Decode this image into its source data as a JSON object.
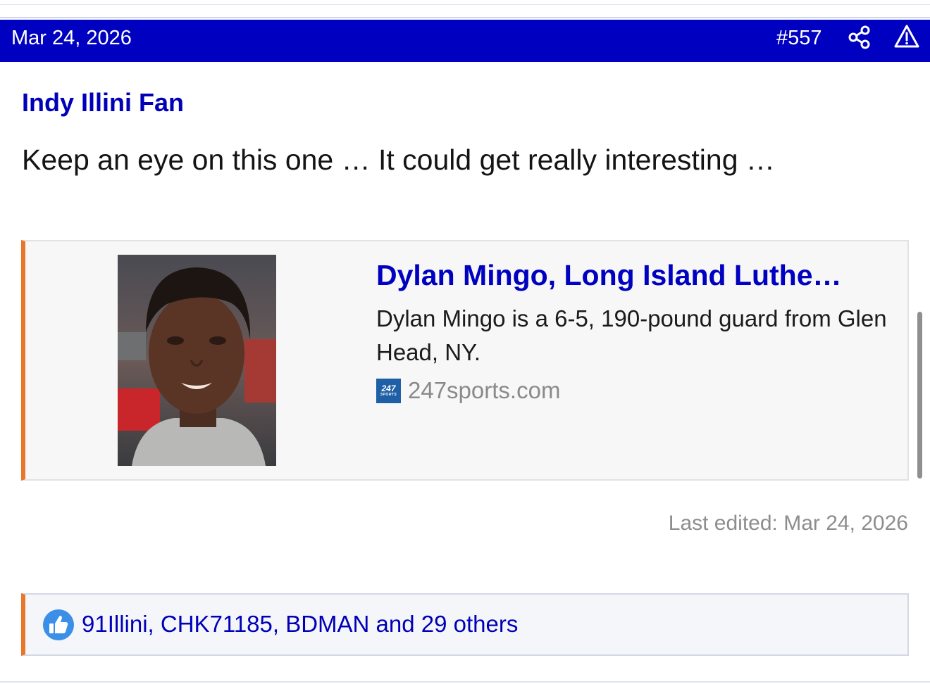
{
  "post": {
    "date": "Mar 24, 2026",
    "number": "#557",
    "author": "Indy Illini Fan",
    "message": "Keep an eye on this one … It could get really interesting …",
    "last_edited": "Last edited: Mar 24, 2026"
  },
  "embed": {
    "title": "Dylan Mingo, Long Island Luthe…",
    "description": "Dylan Mingo is a 6-5, 190-pound guard from Glen Head, NY.",
    "source": "247sports.com",
    "favicon_text": "247",
    "favicon_subtext": "SPORTS"
  },
  "reactions": {
    "text": "91Illini, CHK71185, BDMAN and 29 others"
  },
  "icons": {
    "share": "share-icon",
    "report": "report-warning-icon",
    "like": "thumbs-up-icon"
  },
  "colors": {
    "header_bg": "#0000c0",
    "link": "#0000b8",
    "accent": "#e8762b"
  }
}
